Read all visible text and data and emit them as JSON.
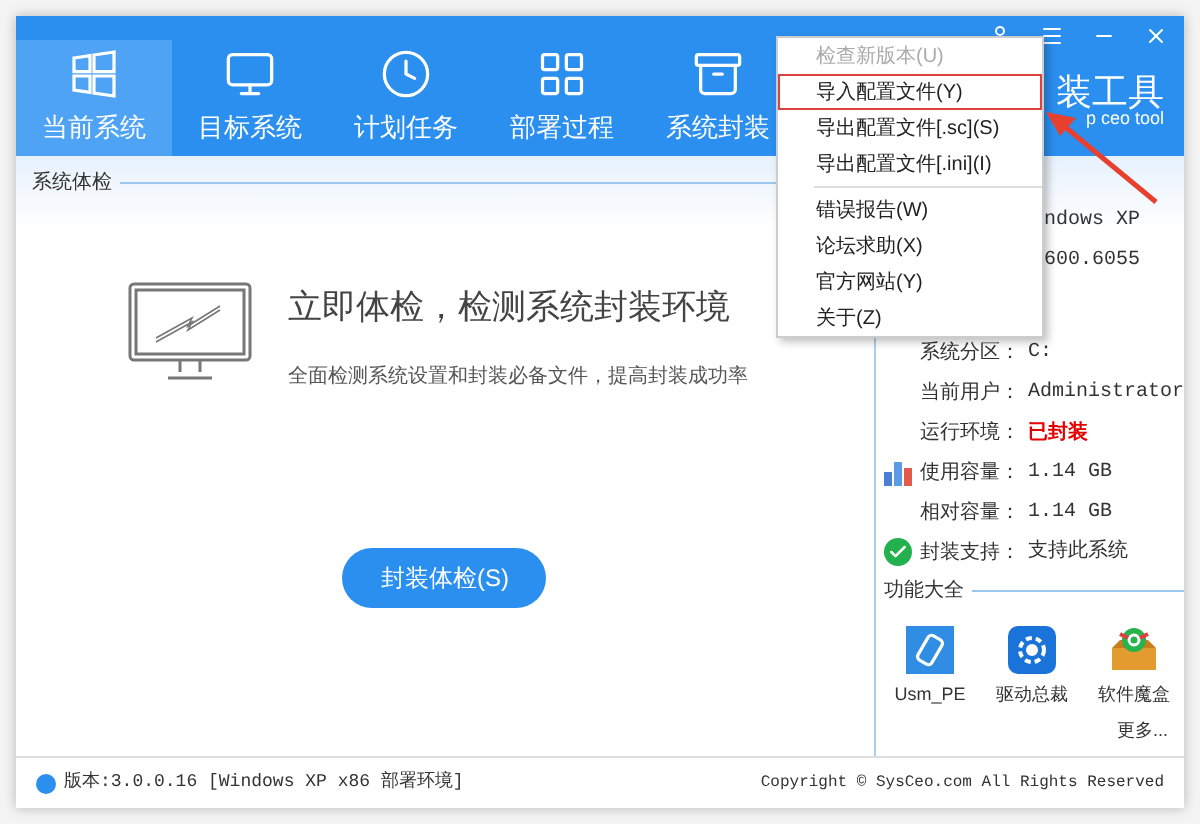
{
  "header": {
    "tabs": [
      {
        "label": "当前系统",
        "kind": "windows",
        "selected": true
      },
      {
        "label": "目标系统",
        "kind": "monitor",
        "selected": false
      },
      {
        "label": "计划任务",
        "kind": "clock",
        "selected": false
      },
      {
        "label": "部署过程",
        "kind": "grid",
        "selected": false
      },
      {
        "label": "系统封装",
        "kind": "box",
        "selected": false
      }
    ],
    "logo_title": "装工具",
    "logo_subtitle": "p ceo tool"
  },
  "menu": {
    "items": [
      {
        "kind": "item",
        "label": "检查新版本(U)",
        "disabled": true,
        "selected": false
      },
      {
        "kind": "item",
        "label": "导入配置文件(Y)",
        "disabled": false,
        "selected": true
      },
      {
        "kind": "item",
        "label": "导出配置文件[.sc](S)",
        "disabled": false,
        "selected": false
      },
      {
        "kind": "item",
        "label": "导出配置文件[.ini](I)",
        "disabled": false,
        "selected": false
      },
      {
        "kind": "separator"
      },
      {
        "kind": "item",
        "label": "错误报告(W)",
        "disabled": false,
        "selected": false
      },
      {
        "kind": "item",
        "label": "论坛求助(X)",
        "disabled": false,
        "selected": false
      },
      {
        "kind": "item",
        "label": "官方网站(Y)",
        "disabled": false,
        "selected": false
      },
      {
        "kind": "item",
        "label": "关于(Z)",
        "disabled": false,
        "selected": false
      }
    ]
  },
  "main": {
    "section_title": "系统体检",
    "headline": "立即体检，检测系统封装环境",
    "subtitle": "全面检测系统设置和封装必备文件，提高封装成功率",
    "button": "封装体检(S)"
  },
  "info": {
    "partial_rows": [
      "ndows XP",
      "600.6055"
    ],
    "rows": [
      {
        "label": "系统分区：",
        "value": "C:",
        "kind": "plain",
        "alert": false
      },
      {
        "label": "当前用户：",
        "value": "Administrator",
        "kind": "plain",
        "alert": false
      },
      {
        "label": "运行环境：",
        "value": "已封装",
        "kind": "plain",
        "alert": true
      },
      {
        "label": "使用容量：",
        "value": "1.14 GB",
        "kind": "chart",
        "alert": false
      },
      {
        "label": "相对容量：",
        "value": "1.14 GB",
        "kind": "plain",
        "alert": false
      },
      {
        "label": "封装支持：",
        "value": "支持此系统",
        "kind": "check",
        "alert": false
      }
    ],
    "tools_title": "功能大全",
    "tools": [
      {
        "label": "Usm_PE",
        "kind": "usb"
      },
      {
        "label": "驱动总裁",
        "kind": "gear"
      },
      {
        "label": "软件魔盒",
        "kind": "package"
      }
    ],
    "more": "更多..."
  },
  "status_bar": {
    "version": "版本:3.0.0.16 [Windows XP x86 部署环境]",
    "copyright": "Copyright © SysCeo.com All Rights Reserved"
  }
}
